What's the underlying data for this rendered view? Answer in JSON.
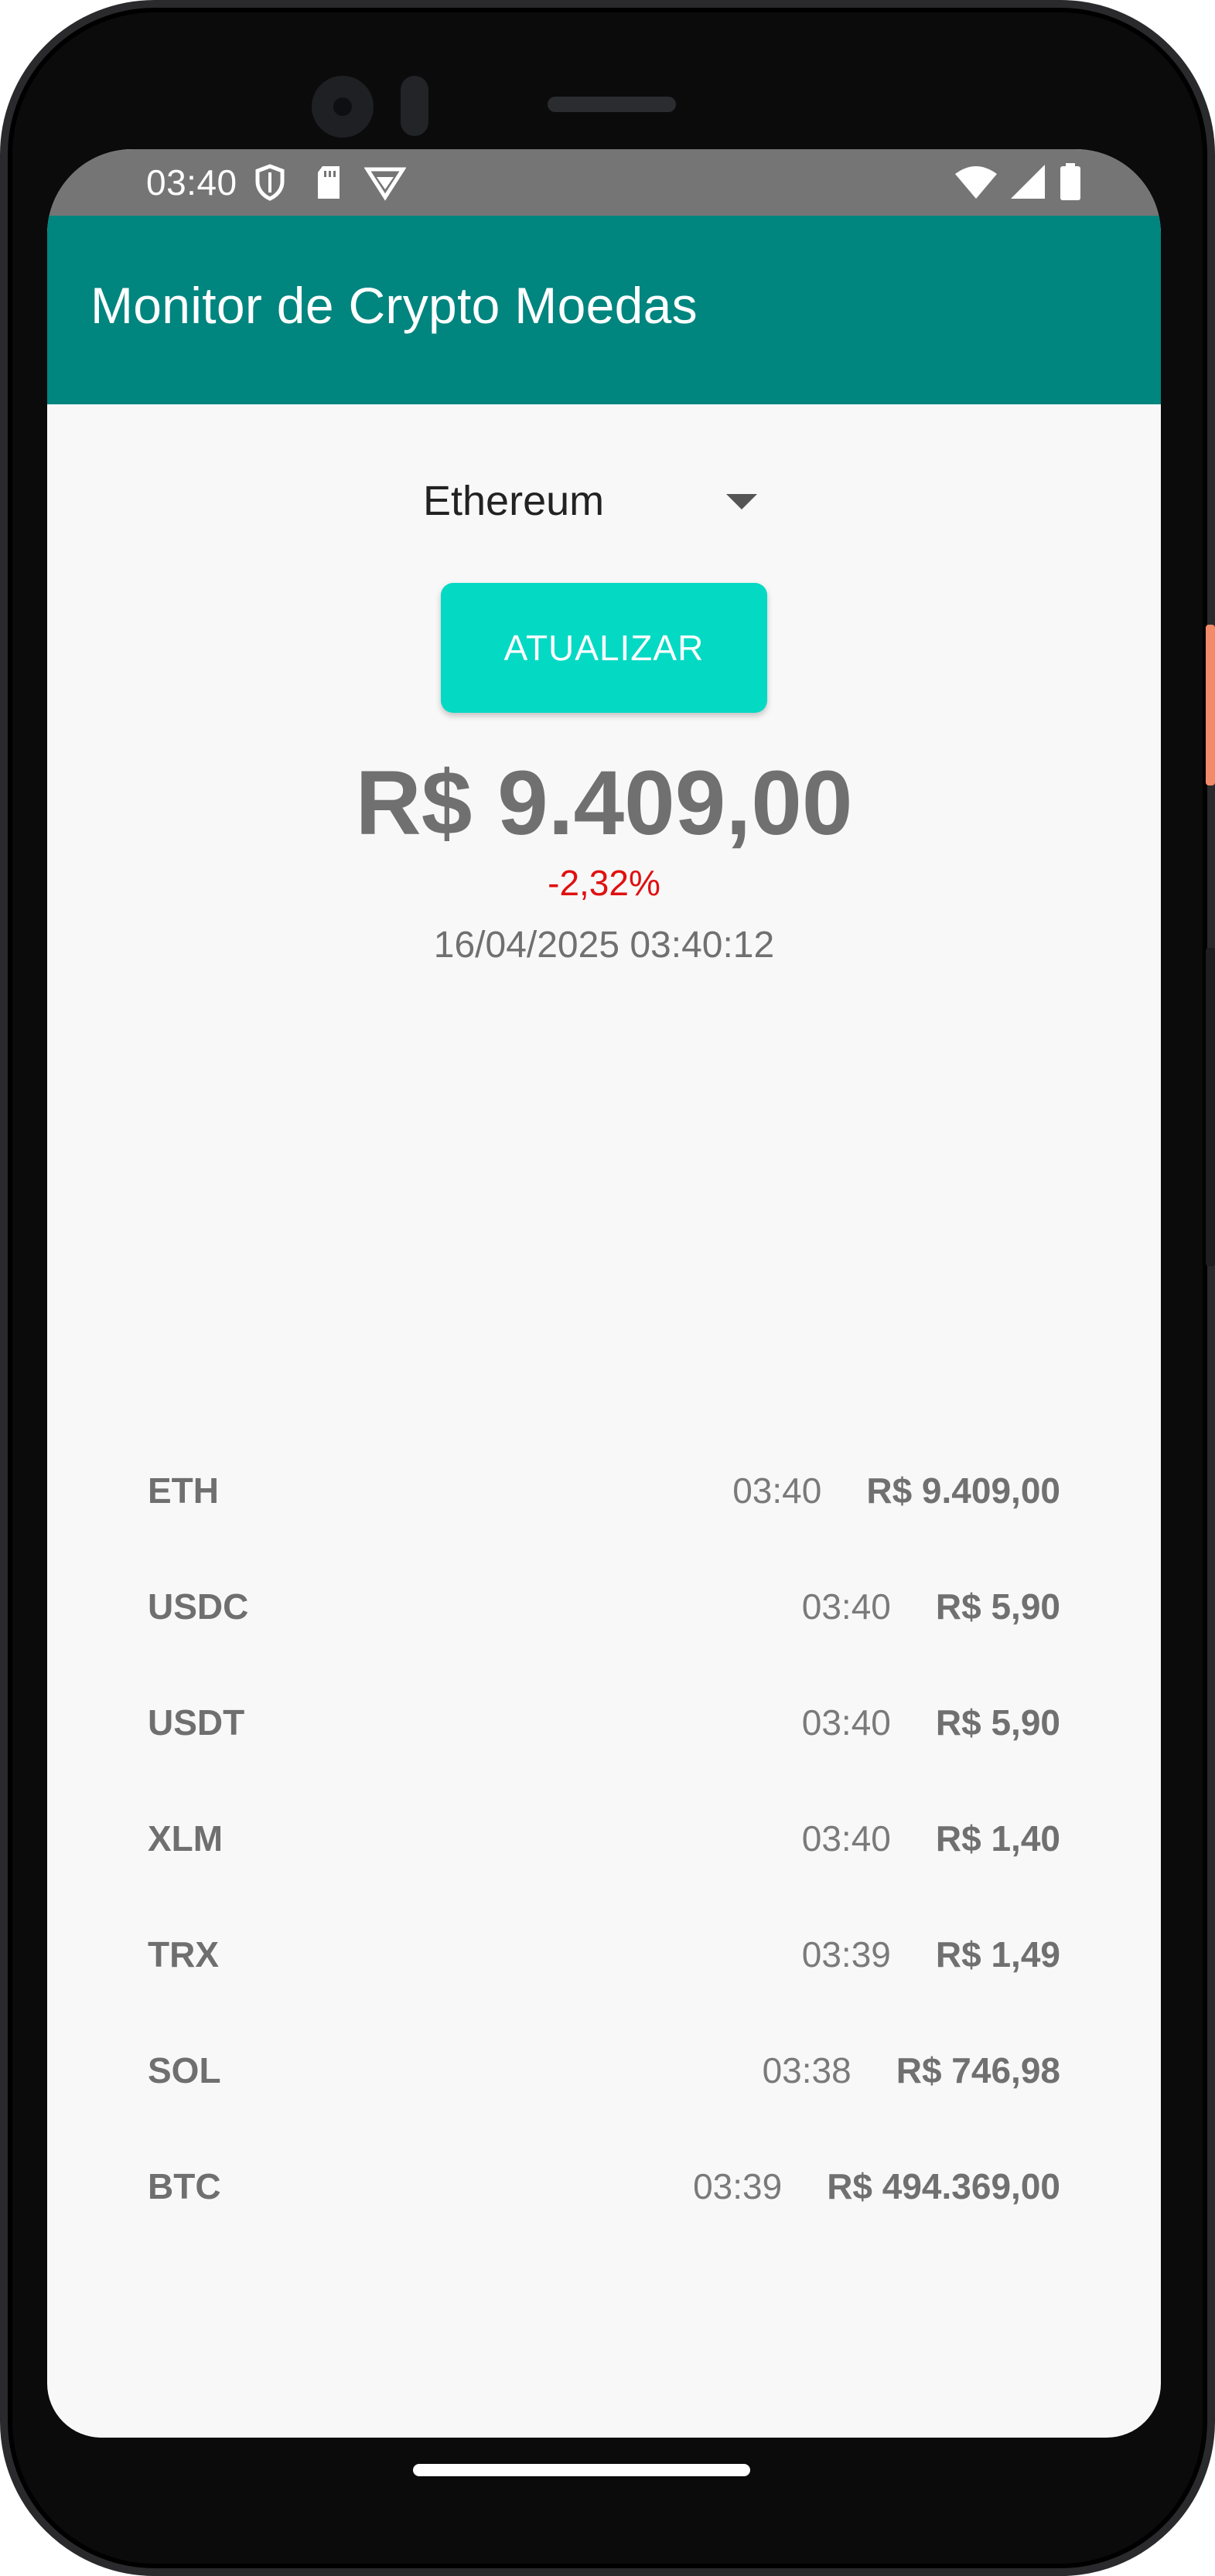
{
  "status_bar": {
    "time": "03:40",
    "left_icons": [
      "shield-icon",
      "sd-card-icon",
      "vpn-icon"
    ],
    "right_icons": [
      "wifi-icon",
      "cell-signal-icon",
      "battery-icon"
    ]
  },
  "app_bar": {
    "title": "Monitor de Crypto Moedas"
  },
  "selector": {
    "selected": "Ethereum"
  },
  "refresh_button": {
    "label": "ATUALIZAR"
  },
  "current": {
    "price": "R$ 9.409,00",
    "change": "-2,32%",
    "timestamp": "16/04/2025 03:40:12"
  },
  "quotes": [
    {
      "symbol": "ETH",
      "time": "03:40",
      "price": "R$ 9.409,00"
    },
    {
      "symbol": "USDC",
      "time": "03:40",
      "price": "R$ 5,90"
    },
    {
      "symbol": "USDT",
      "time": "03:40",
      "price": "R$ 5,90"
    },
    {
      "symbol": "XLM",
      "time": "03:40",
      "price": "R$ 1,40"
    },
    {
      "symbol": "TRX",
      "time": "03:39",
      "price": "R$ 1,49"
    },
    {
      "symbol": "SOL",
      "time": "03:38",
      "price": "R$ 746,98"
    },
    {
      "symbol": "BTC",
      "time": "03:39",
      "price": "R$ 494.369,00"
    }
  ],
  "colors": {
    "app_bar": "#00857f",
    "button": "#04d9c4",
    "negative_change": "#e01010",
    "status_bar": "#757575"
  }
}
